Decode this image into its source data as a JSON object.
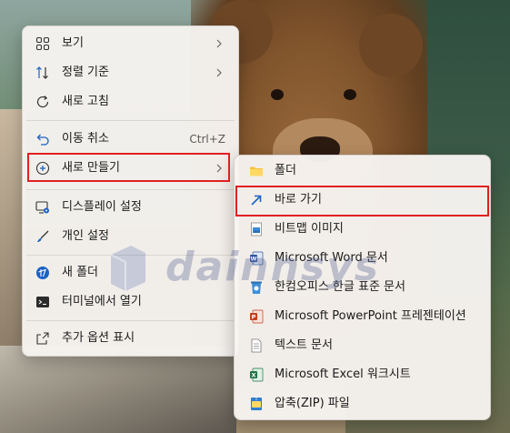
{
  "main_menu": {
    "items": [
      {
        "label": "보기",
        "icon": "grid-view-icon",
        "has_submenu": true
      },
      {
        "label": "정렬 기준",
        "icon": "sort-icon",
        "has_submenu": true
      },
      {
        "label": "새로 고침",
        "icon": "refresh-icon"
      },
      {
        "label": "이동 취소",
        "icon": "undo-icon",
        "shortcut": "Ctrl+Z"
      },
      {
        "label": "새로 만들기",
        "icon": "new-plus-icon",
        "has_submenu": true
      },
      {
        "label": "디스플레이 설정",
        "icon": "display-settings-icon"
      },
      {
        "label": "개인 설정",
        "icon": "brush-icon"
      },
      {
        "label": "새 폴더",
        "icon": "new-folder-icon"
      },
      {
        "label": "터미널에서 열기",
        "icon": "terminal-icon"
      },
      {
        "label": "추가 옵션 표시",
        "icon": "more-options-icon"
      }
    ]
  },
  "new_submenu": {
    "items": [
      {
        "label": "폴더",
        "icon": "folder-icon"
      },
      {
        "label": "바로 가기",
        "icon": "shortcut-arrow-icon"
      },
      {
        "label": "비트맵 이미지",
        "icon": "bitmap-icon"
      },
      {
        "label": "Microsoft Word 문서",
        "icon": "word-icon"
      },
      {
        "label": "한컴오피스 한글 표준 문서",
        "icon": "hwp-icon"
      },
      {
        "label": "Microsoft PowerPoint 프레젠테이션",
        "icon": "powerpoint-icon"
      },
      {
        "label": "텍스트 문서",
        "icon": "text-document-icon"
      },
      {
        "label": "Microsoft Excel 워크시트",
        "icon": "excel-icon"
      },
      {
        "label": "압축(ZIP) 파일",
        "icon": "zip-icon"
      }
    ]
  },
  "highlights": [
    "새로 만들기",
    "바로 가기"
  ],
  "watermark": "dainnsys",
  "colors": {
    "highlight_border": "#e02020",
    "accent_blue": "#1a62c7",
    "word_blue": "#2b579a",
    "ppt_orange": "#c43e1c",
    "excel_green": "#217346",
    "folder_yellow": "#f4c242"
  }
}
